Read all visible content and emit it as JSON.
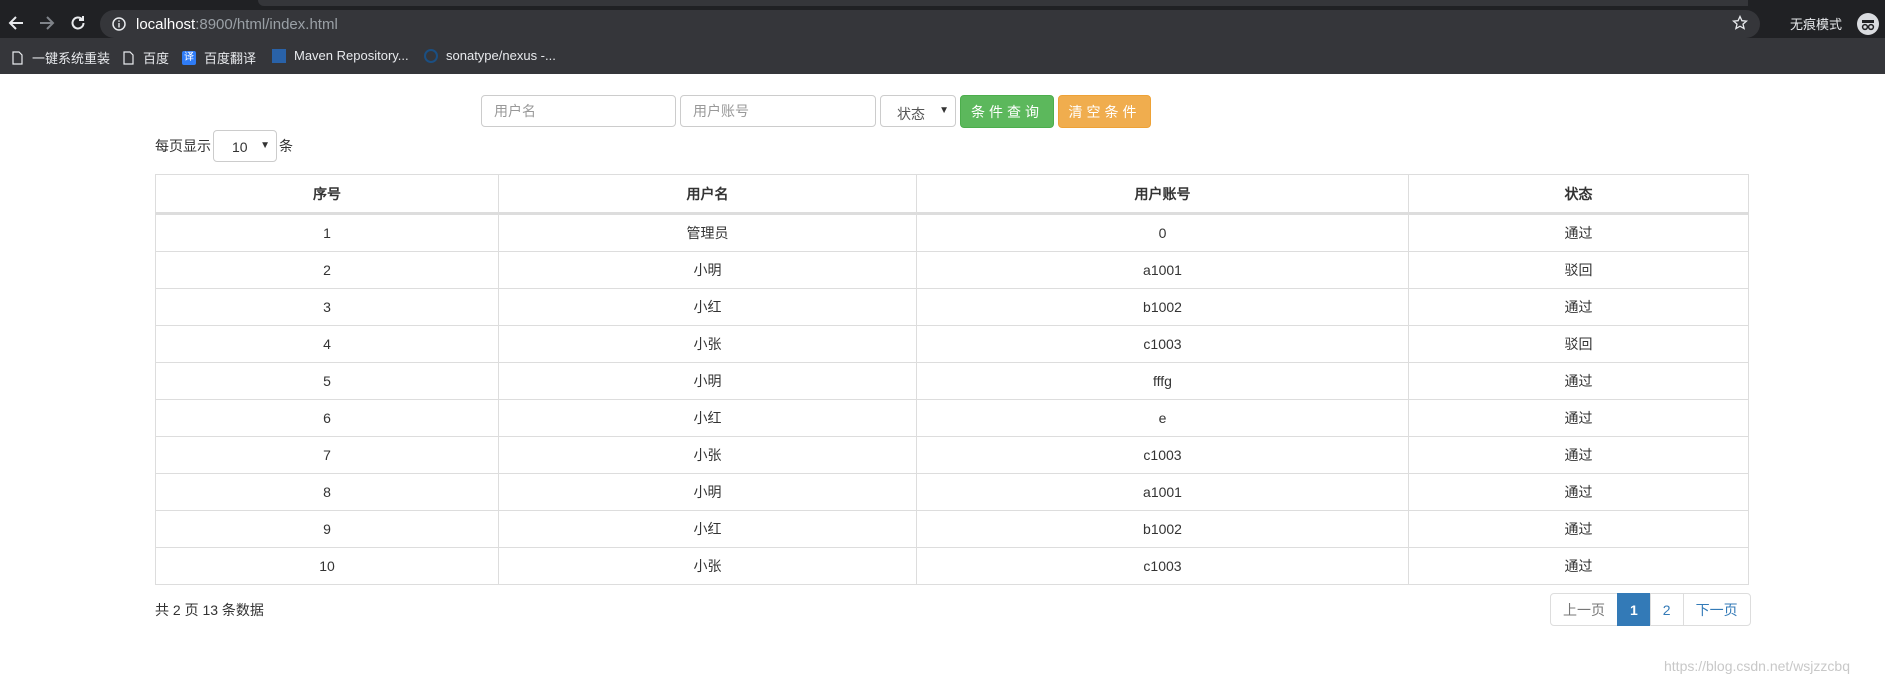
{
  "browser": {
    "url_host": "localhost",
    "url_rest": ":8900/html/index.html",
    "incognito_label": "无痕模式",
    "bookmarks": [
      {
        "label": "一键系统重装"
      },
      {
        "label": "百度"
      },
      {
        "label": "百度翻译"
      },
      {
        "label": "Maven Repository..."
      },
      {
        "label": "sonatype/nexus -..."
      }
    ]
  },
  "filters": {
    "username_placeholder": "用户名",
    "account_placeholder": "用户账号",
    "status_label": "状态",
    "query_button": "条件查询",
    "clear_button": "清空条件"
  },
  "pagesize": {
    "prefix": "每页显示",
    "value": "10",
    "suffix": "条"
  },
  "table": {
    "headers": [
      "序号",
      "用户名",
      "用户账号",
      "状态"
    ],
    "rows": [
      [
        "1",
        "管理员",
        "0",
        "通过"
      ],
      [
        "2",
        "小明",
        "a1001",
        "驳回"
      ],
      [
        "3",
        "小红",
        "b1002",
        "通过"
      ],
      [
        "4",
        "小张",
        "c1003",
        "驳回"
      ],
      [
        "5",
        "小明",
        "fffg",
        "通过"
      ],
      [
        "6",
        "小红",
        "e",
        "通过"
      ],
      [
        "7",
        "小张",
        "c1003",
        "通过"
      ],
      [
        "8",
        "小明",
        "a1001",
        "通过"
      ],
      [
        "9",
        "小红",
        "b1002",
        "通过"
      ],
      [
        "10",
        "小张",
        "c1003",
        "通过"
      ]
    ]
  },
  "summary": "共 2 页 13 条数据",
  "pagination": {
    "prev": "上一页",
    "pages": [
      "1",
      "2"
    ],
    "active": "1",
    "next": "下一页"
  },
  "watermark": "https://blog.csdn.net/wsjzzcbq"
}
